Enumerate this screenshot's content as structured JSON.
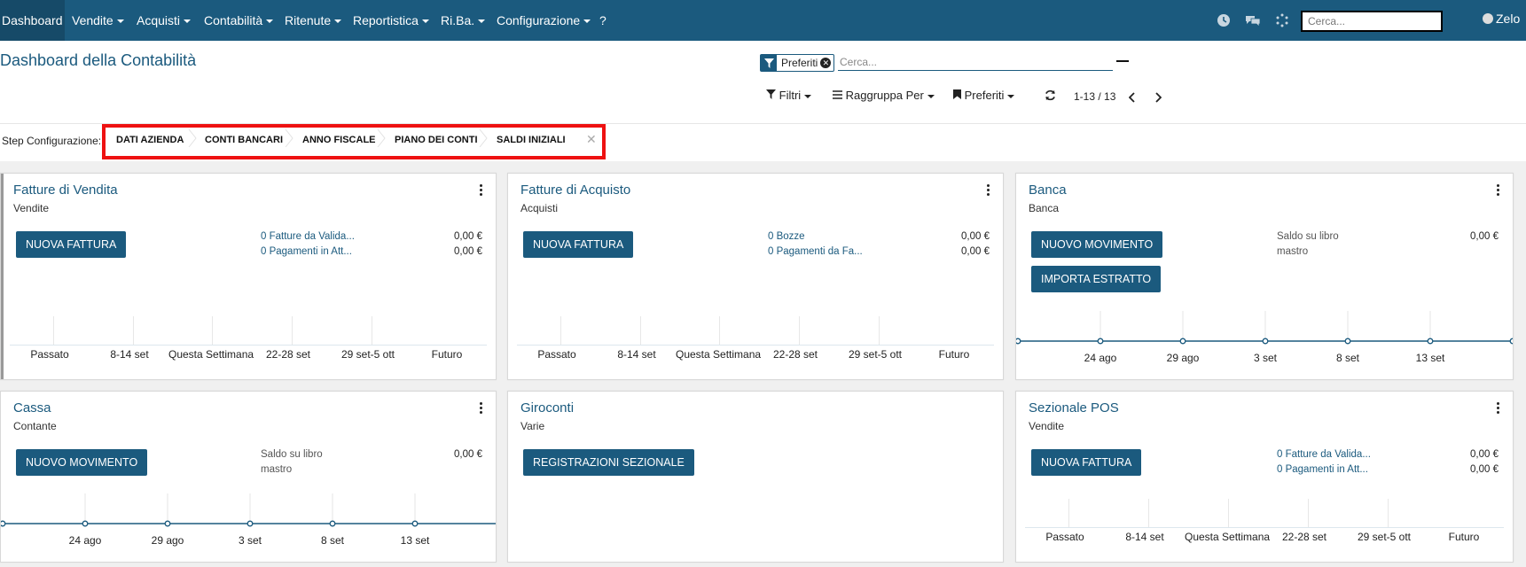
{
  "nav": {
    "items": [
      "Dashboard",
      "Vendite",
      "Acquisti",
      "Contabilità",
      "Ritenute",
      "Reportistica",
      "Ri.Ba.",
      "Configurazione",
      "?"
    ],
    "search_placeholder": "Cerca...",
    "user": "Zelo"
  },
  "control": {
    "title": "Dashboard della Contabilità",
    "facet": "Preferiti",
    "search_placeholder": "Cerca...",
    "filters": "Filtri",
    "group_by": "Raggruppa Per",
    "favorites": "Preferiti",
    "pager": "1-13 / 13"
  },
  "steps": {
    "label": "Step Configurazione:",
    "items": [
      "DATI AZIENDA",
      "CONTI BANCARI",
      "ANNO FISCALE",
      "PIANO DEI CONTI",
      "SALDI INIZIALI"
    ]
  },
  "colors": {
    "brand": "#1b5a7e",
    "highlight": "#e11111"
  },
  "cards": {
    "sales": {
      "title": "Fatture di Vendita",
      "subtitle": "Vendite",
      "button": "NUOVA FATTURA",
      "stats": [
        {
          "label": "0 Fatture da Valida...",
          "amount": "0,00 €"
        },
        {
          "label": "0 Pagamenti in Att...",
          "amount": "0,00 €"
        }
      ],
      "x_labels": [
        "Passato",
        "8-14 set",
        "Questa Settimana",
        "22-28 set",
        "29 set-5 ott",
        "Futuro"
      ]
    },
    "purchase": {
      "title": "Fatture di Acquisto",
      "subtitle": "Acquisti",
      "button": "NUOVA FATTURA",
      "stats": [
        {
          "label": "0 Bozze",
          "amount": "0,00 €"
        },
        {
          "label": "0 Pagamenti da Fa...",
          "amount": "0,00 €"
        }
      ],
      "x_labels": [
        "Passato",
        "8-14 set",
        "Questa Settimana",
        "22-28 set",
        "29 set-5 ott",
        "Futuro"
      ]
    },
    "bank": {
      "title": "Banca",
      "subtitle": "Banca",
      "button": "NUOVO MOVIMENTO",
      "button2": "IMPORTA ESTRATTO",
      "balance_label_1": "Saldo su libro",
      "balance_label_2": "mastro",
      "amount": "0,00 €",
      "x_labels": [
        "24 ago",
        "29 ago",
        "3 set",
        "8 set",
        "13 set"
      ]
    },
    "cash": {
      "title": "Cassa",
      "subtitle": "Contante",
      "button": "NUOVO MOVIMENTO",
      "balance_label_1": "Saldo su libro",
      "balance_label_2": "mastro",
      "amount": "0,00 €",
      "x_labels": [
        "24 ago",
        "29 ago",
        "3 set",
        "8 set",
        "13 set"
      ]
    },
    "giroconti": {
      "title": "Giroconti",
      "subtitle": "Varie",
      "button": "REGISTRAZIONI SEZIONALE"
    },
    "pos": {
      "title": "Sezionale POS",
      "subtitle": "Vendite",
      "button": "NUOVA FATTURA",
      "stats": [
        {
          "label": "0 Fatture da Valida...",
          "amount": "0,00 €"
        },
        {
          "label": "0 Pagamenti in Att...",
          "amount": "0,00 €"
        }
      ],
      "x_labels": [
        "Passato",
        "8-14 set",
        "Questa Settimana",
        "22-28 set",
        "29 set-5 ott",
        "Futuro"
      ]
    }
  }
}
